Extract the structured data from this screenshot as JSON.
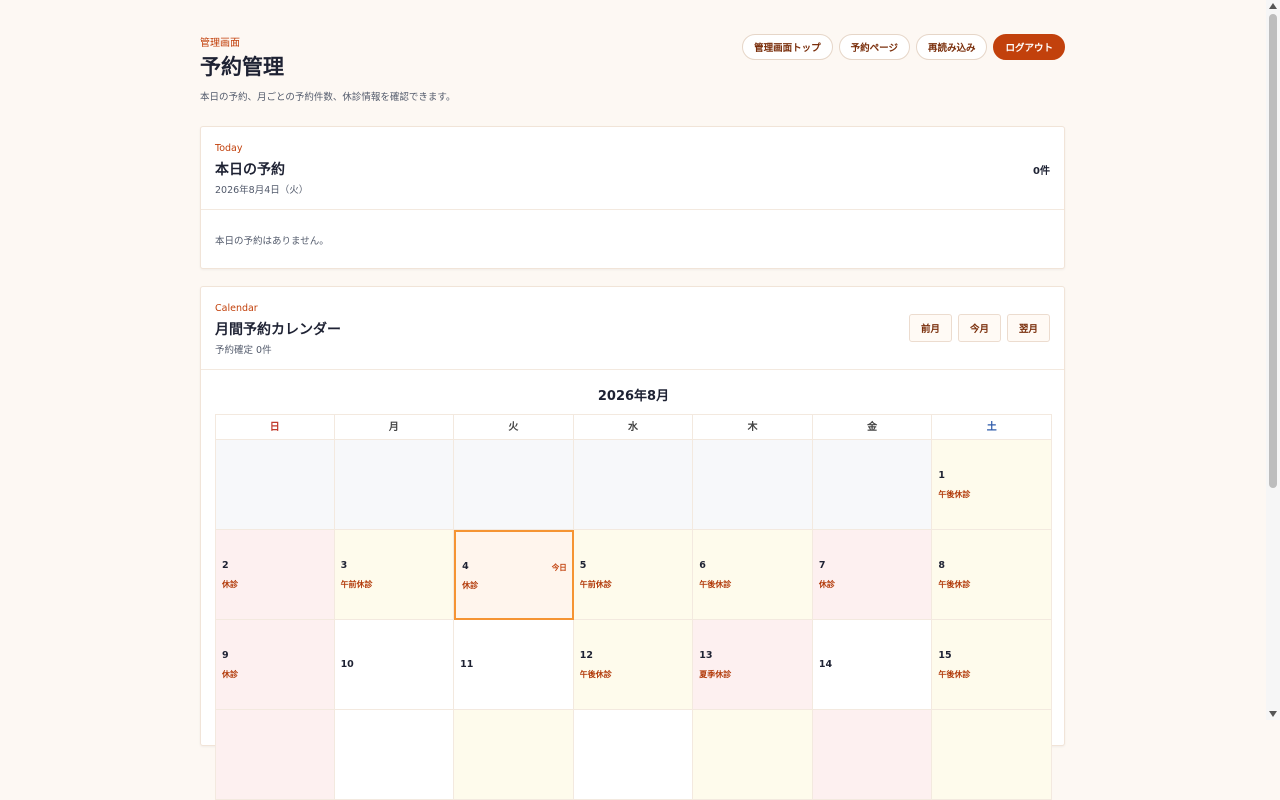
{
  "header": {
    "eyebrow": "管理画面",
    "title": "予約管理",
    "subtitle": "本日の予約、月ごとの予約件数、休診情報を確認できます。",
    "buttons": {
      "admin_top": "管理画面トップ",
      "reservation_page": "予約ページ",
      "reload": "再読み込み",
      "logout": "ログアウト"
    }
  },
  "today": {
    "eyebrow": "Today",
    "title": "本日の予約",
    "date": "2026年8月4日（火）",
    "count": "0件",
    "empty_message": "本日の予約はありません。"
  },
  "calendar": {
    "eyebrow": "Calendar",
    "title": "月間予約カレンダー",
    "summary": "予約確定 0件",
    "nav": {
      "prev": "前月",
      "current": "今月",
      "next": "翌月"
    },
    "month_label": "2026年8月",
    "weekdays": [
      "日",
      "月",
      "火",
      "水",
      "木",
      "金",
      "土"
    ],
    "today_label": "今日",
    "days": [
      {
        "day": "",
        "status": "",
        "type": "empty"
      },
      {
        "day": "",
        "status": "",
        "type": "empty"
      },
      {
        "day": "",
        "status": "",
        "type": "empty"
      },
      {
        "day": "",
        "status": "",
        "type": "empty"
      },
      {
        "day": "",
        "status": "",
        "type": "empty"
      },
      {
        "day": "",
        "status": "",
        "type": "empty"
      },
      {
        "day": "1",
        "status": "午後休診",
        "type": "half"
      },
      {
        "day": "2",
        "status": "休診",
        "type": "full"
      },
      {
        "day": "3",
        "status": "午前休診",
        "type": "half"
      },
      {
        "day": "4",
        "status": "休診",
        "type": "today"
      },
      {
        "day": "5",
        "status": "午前休診",
        "type": "half"
      },
      {
        "day": "6",
        "status": "午後休診",
        "type": "half"
      },
      {
        "day": "7",
        "status": "休診",
        "type": "full"
      },
      {
        "day": "8",
        "status": "午後休診",
        "type": "half"
      },
      {
        "day": "9",
        "status": "休診",
        "type": "full"
      },
      {
        "day": "10",
        "status": "",
        "type": "normal"
      },
      {
        "day": "11",
        "status": "",
        "type": "normal"
      },
      {
        "day": "12",
        "status": "午後休診",
        "type": "half"
      },
      {
        "day": "13",
        "status": "夏季休診",
        "type": "full"
      },
      {
        "day": "14",
        "status": "",
        "type": "normal"
      },
      {
        "day": "15",
        "status": "午後休診",
        "type": "half"
      },
      {
        "day": "",
        "status": "",
        "type": "full"
      },
      {
        "day": "",
        "status": "",
        "type": "normal"
      },
      {
        "day": "",
        "status": "",
        "type": "half"
      },
      {
        "day": "",
        "status": "",
        "type": "normal"
      },
      {
        "day": "",
        "status": "",
        "type": "half"
      },
      {
        "day": "",
        "status": "",
        "type": "full"
      },
      {
        "day": "",
        "status": "",
        "type": "half"
      }
    ]
  }
}
